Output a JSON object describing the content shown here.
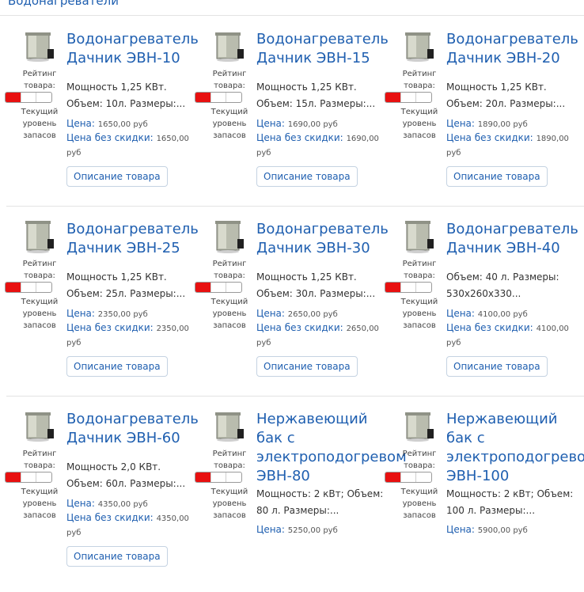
{
  "page": {
    "heading": "Водонагреватели"
  },
  "common": {
    "rating_label": "Рейтинг товара:",
    "stock_label": "Текущий уровень запасов",
    "price_label": "Цена:",
    "price_nodisc_label": "Цена без скидки:",
    "button_label": "Описание товара",
    "stock_level_segments_on": 1,
    "stock_level_segments_total": 3,
    "accent_color": "#1f5fb0",
    "stock_color": "#e81010"
  },
  "products": [
    {
      "title_line1": "Водонагреватель",
      "title_line2": "Дачник ЭВН-10",
      "title_line3": "",
      "title_line4": "",
      "desc1": "Мощность 1,25 КВт.",
      "desc2": "Объем: 10л. Размеры:...",
      "price": "1650,00 руб",
      "price_nodisc": "1650,00 руб"
    },
    {
      "title_line1": "Водонагреватель",
      "title_line2": "Дачник ЭВН-15",
      "title_line3": "",
      "title_line4": "",
      "desc1": "Мощность 1,25 КВт.",
      "desc2": "Объем: 15л. Размеры:...",
      "price": "1690,00 руб",
      "price_nodisc": "1690,00 руб"
    },
    {
      "title_line1": "Водонагреватель",
      "title_line2": "Дачник ЭВН-20",
      "title_line3": "",
      "title_line4": "",
      "desc1": "Мощность 1,25 КВт.",
      "desc2": "Объем: 20л. Размеры:...",
      "price": "1890,00 руб",
      "price_nodisc": "1890,00 руб"
    },
    {
      "title_line1": "Водонагреватель",
      "title_line2": "Дачник ЭВН-25",
      "title_line3": "",
      "title_line4": "",
      "desc1": "Мощность 1,25 КВт.",
      "desc2": "Объем: 25л. Размеры:...",
      "price": "2350,00 руб",
      "price_nodisc": "2350,00 руб"
    },
    {
      "title_line1": "Водонагреватель",
      "title_line2": "Дачник ЭВН-30",
      "title_line3": "",
      "title_line4": "",
      "desc1": "Мощность 1,25 КВт.",
      "desc2": "Объем: 30л. Размеры:...",
      "price": "2650,00 руб",
      "price_nodisc": "2650,00 руб"
    },
    {
      "title_line1": "Водонагреватель",
      "title_line2": "Дачник ЭВН-40",
      "title_line3": "",
      "title_line4": "",
      "desc1": "Объем: 40 л. Размеры:",
      "desc2": "530x260x330...",
      "price": "4100,00 руб",
      "price_nodisc": "4100,00 руб"
    },
    {
      "title_line1": "Водонагреватель",
      "title_line2": "Дачник ЭВН-60",
      "title_line3": "",
      "title_line4": "",
      "desc1": "Мощность 2,0 КВт.",
      "desc2": "Объем: 60л. Размеры:...",
      "price": "4350,00 руб",
      "price_nodisc": "4350,00 руб"
    },
    {
      "title_line1": "Нержавеющий",
      "title_line2": "бак с",
      "title_line3": "электроподогревом",
      "title_line4": "ЭВН-80",
      "desc1": "Мощность: 2 кВт; Объем:",
      "desc2": "80 л. Размеры:...",
      "price": "5250,00 руб",
      "price_nodisc": ""
    },
    {
      "title_line1": "Нержавеющий",
      "title_line2": "бак с",
      "title_line3": "электроподогревом",
      "title_line4": "ЭВН-100",
      "desc1": "Мощность: 2 кВт; Объем:",
      "desc2": "100 л. Размеры:...",
      "price": "5900,00 руб",
      "price_nodisc": ""
    }
  ]
}
